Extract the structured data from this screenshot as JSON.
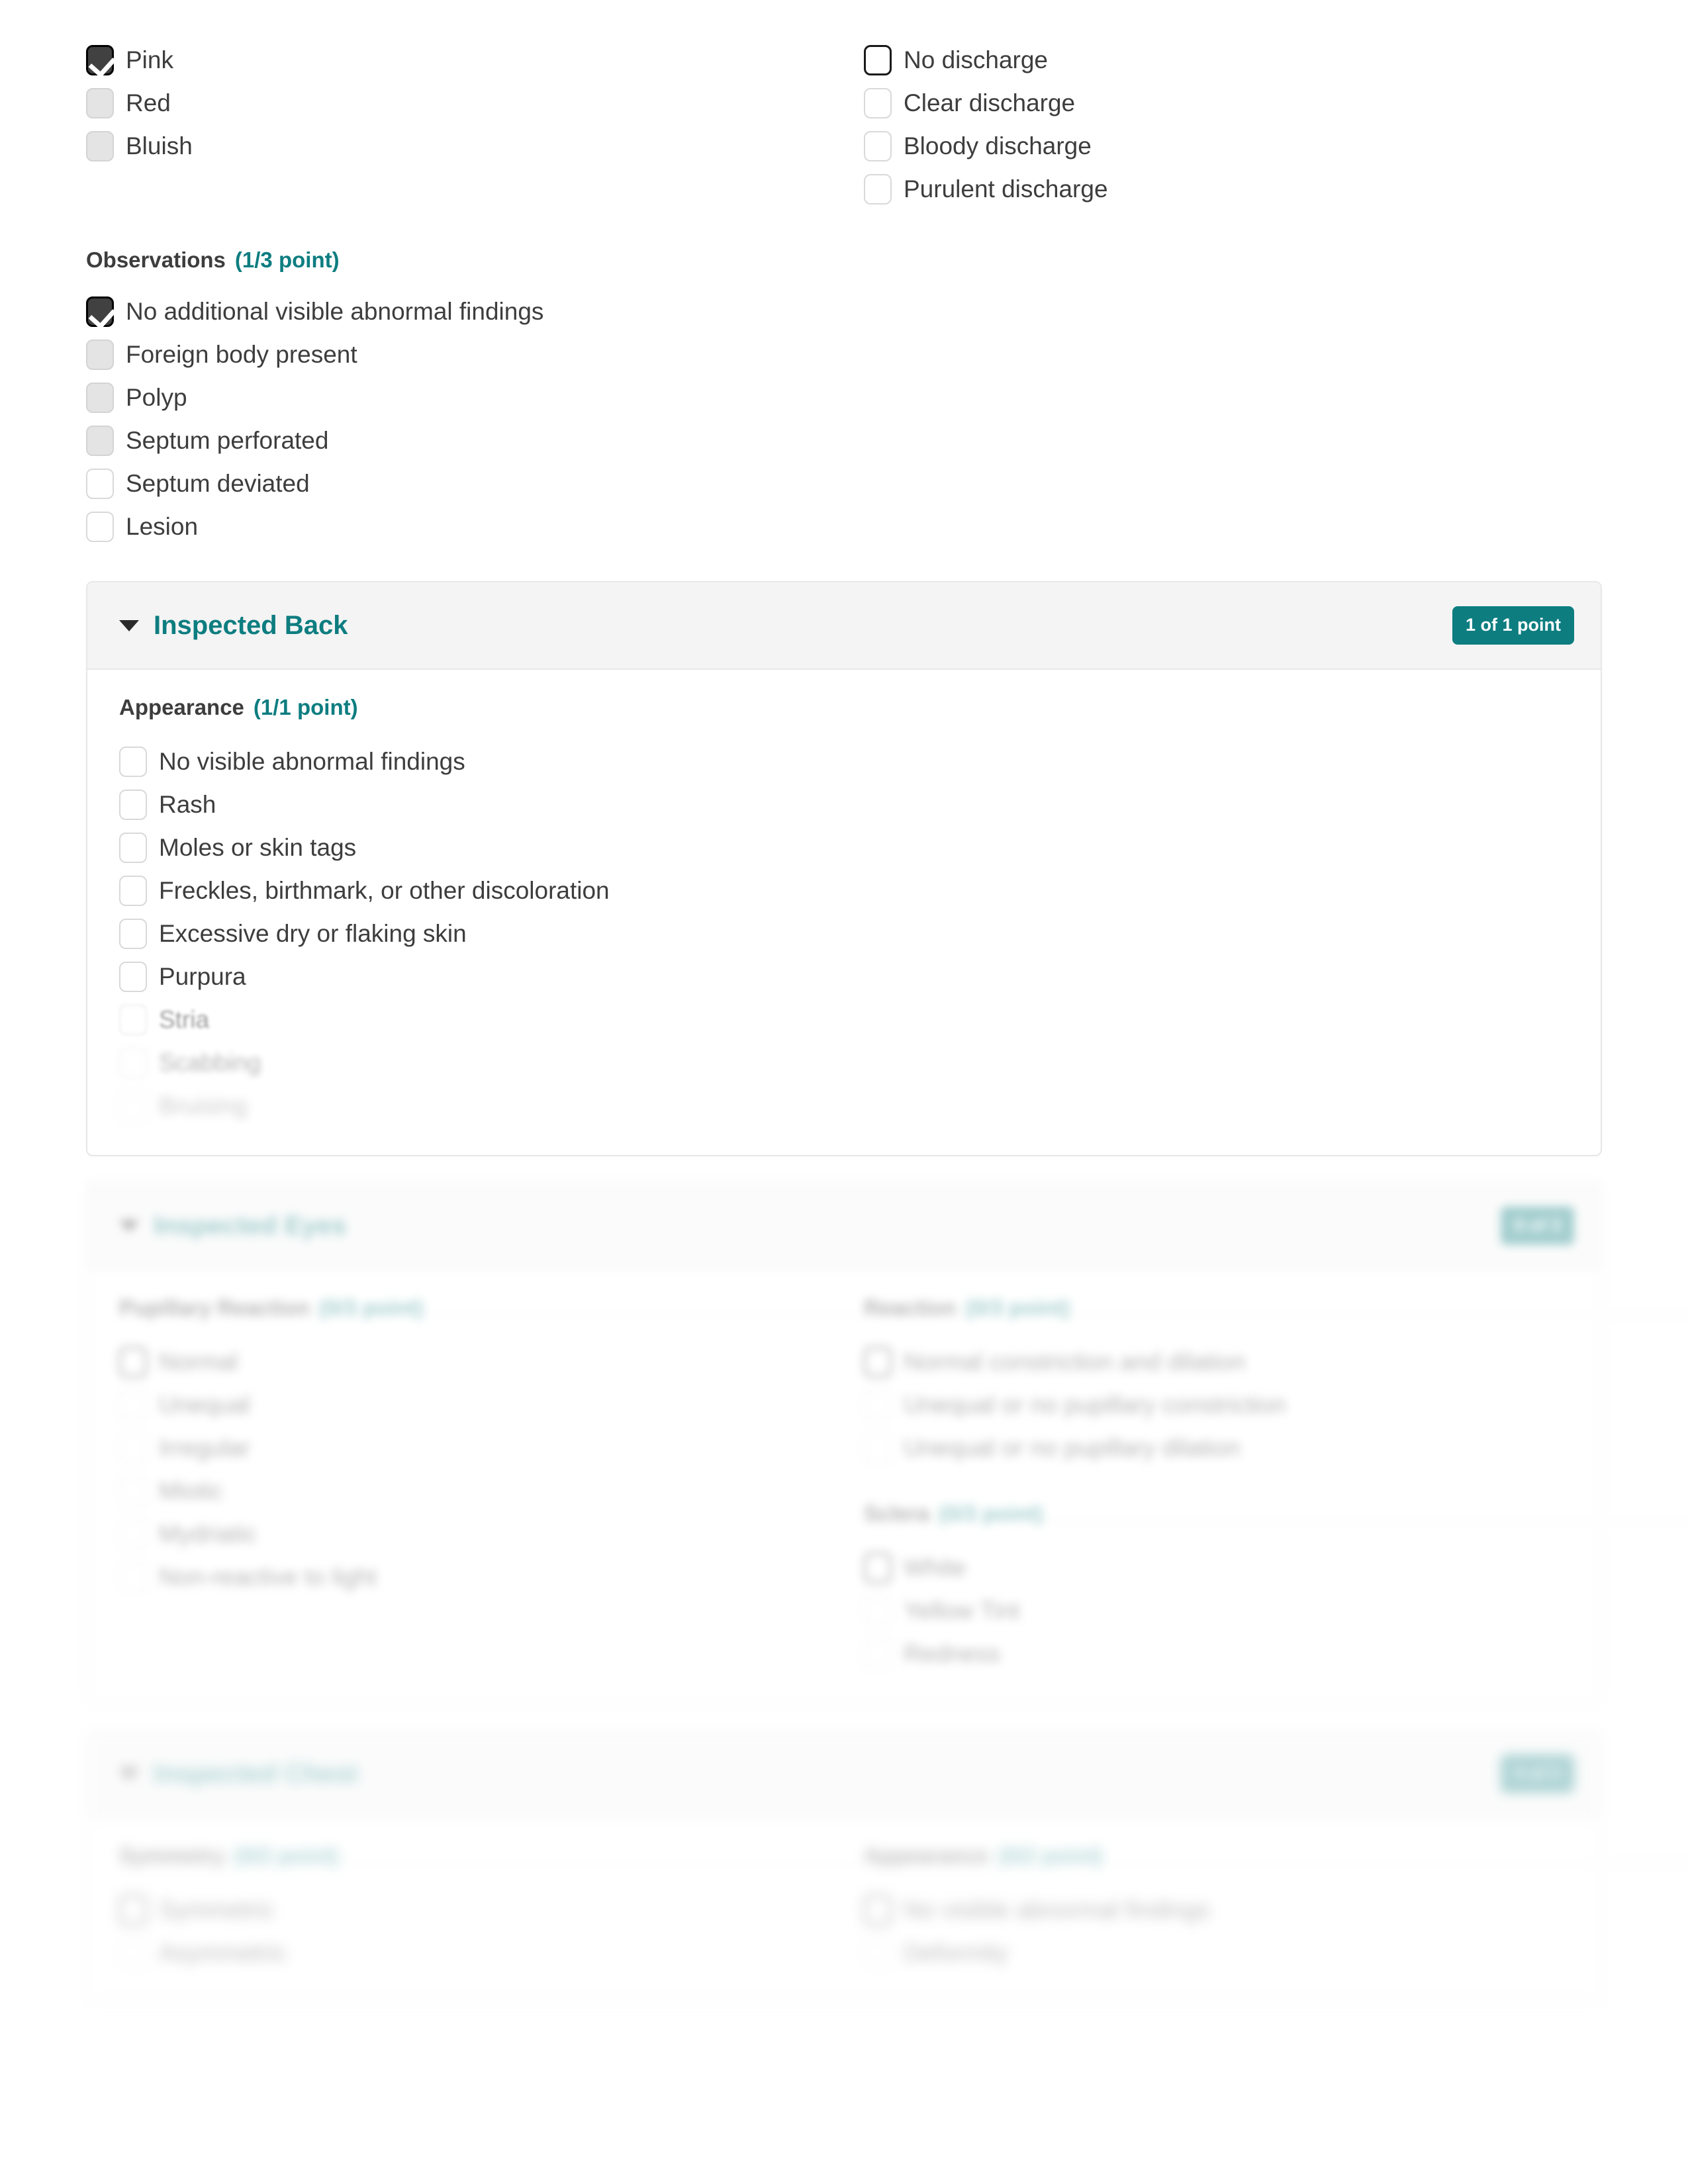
{
  "colors": {
    "accent": "#0d7d80",
    "text": "#3d3d3d",
    "card_header_bg": "#f4f4f4",
    "border": "#e8e8e8"
  },
  "nose_color": {
    "options": [
      {
        "label": "Pink",
        "state": "checked"
      },
      {
        "label": "Red",
        "state": "shaded"
      },
      {
        "label": "Bluish",
        "state": "shaded"
      }
    ]
  },
  "discharge": {
    "options": [
      {
        "label": "No discharge",
        "state": "focus"
      },
      {
        "label": "Clear discharge",
        "state": "empty"
      },
      {
        "label": "Bloody discharge",
        "state": "empty"
      },
      {
        "label": "Purulent discharge",
        "state": "empty"
      }
    ]
  },
  "observations": {
    "heading": "Observations",
    "points": "(1/3 point)",
    "options": [
      {
        "label": "No additional visible abnormal findings",
        "state": "checked"
      },
      {
        "label": "Foreign body present",
        "state": "shaded"
      },
      {
        "label": "Polyp",
        "state": "shaded"
      },
      {
        "label": "Septum perforated",
        "state": "shaded"
      },
      {
        "label": "Septum deviated",
        "state": "empty"
      },
      {
        "label": "Lesion",
        "state": "empty"
      }
    ]
  },
  "inspected_back": {
    "title": "Inspected Back",
    "badge": "1 of 1 point",
    "chevron": "chevron-down-icon",
    "appearance": {
      "heading": "Appearance",
      "points": "(1/1 point)",
      "options": [
        {
          "label": "No visible abnormal findings",
          "state": "empty"
        },
        {
          "label": "Rash",
          "state": "empty"
        },
        {
          "label": "Moles or skin tags",
          "state": "empty"
        },
        {
          "label": "Freckles, birthmark, or other discoloration",
          "state": "empty"
        },
        {
          "label": "Excessive dry or flaking skin",
          "state": "empty"
        },
        {
          "label": "Purpura",
          "state": "empty"
        },
        {
          "label": "Stria",
          "state": "empty"
        },
        {
          "label": "Scabbing",
          "state": "empty"
        },
        {
          "label": "Bruising",
          "state": "empty"
        }
      ]
    }
  },
  "inspected_eyes": {
    "title": "Inspected Eyes",
    "badge": "0 of 3",
    "chevron": "chevron-down-icon",
    "pupillary_reaction": {
      "heading": "Pupillary Reaction",
      "points": "(0/3 point)",
      "options": [
        {
          "label": "Normal",
          "state": "focus"
        },
        {
          "label": "Unequal",
          "state": "empty"
        },
        {
          "label": "Irregular",
          "state": "empty"
        },
        {
          "label": "Miotic",
          "state": "empty"
        },
        {
          "label": "Mydriatic",
          "state": "empty"
        },
        {
          "label": "Non-reactive to light",
          "state": "empty"
        }
      ]
    },
    "reaction": {
      "heading": "Reaction",
      "points": "(0/3 point)",
      "options": [
        {
          "label": "Normal constriction and dilation",
          "state": "focus"
        },
        {
          "label": "Unequal or no pupillary constriction",
          "state": "empty"
        },
        {
          "label": "Unequal or no pupillary dilation",
          "state": "empty"
        }
      ]
    },
    "sclera": {
      "heading": "Sclera",
      "points": "(0/3 point)",
      "options": [
        {
          "label": "White",
          "state": "focus"
        },
        {
          "label": "Yellow Tint",
          "state": "empty"
        },
        {
          "label": "Redness",
          "state": "empty"
        }
      ]
    }
  },
  "inspected_chest": {
    "title": "Inspected Chest",
    "badge": "0 of 3",
    "chevron": "chevron-down-icon",
    "symmetry": {
      "heading": "Symmetry",
      "points": "(0/2 point)",
      "options": [
        {
          "label": "Symmetric",
          "state": "focus"
        },
        {
          "label": "Asymmetric",
          "state": "empty"
        }
      ]
    },
    "appearance": {
      "heading": "Appearance",
      "points": "(0/2 point)",
      "options": [
        {
          "label": "No visible abnormal findings",
          "state": "focus"
        },
        {
          "label": "Deformity",
          "state": "empty"
        }
      ]
    }
  }
}
